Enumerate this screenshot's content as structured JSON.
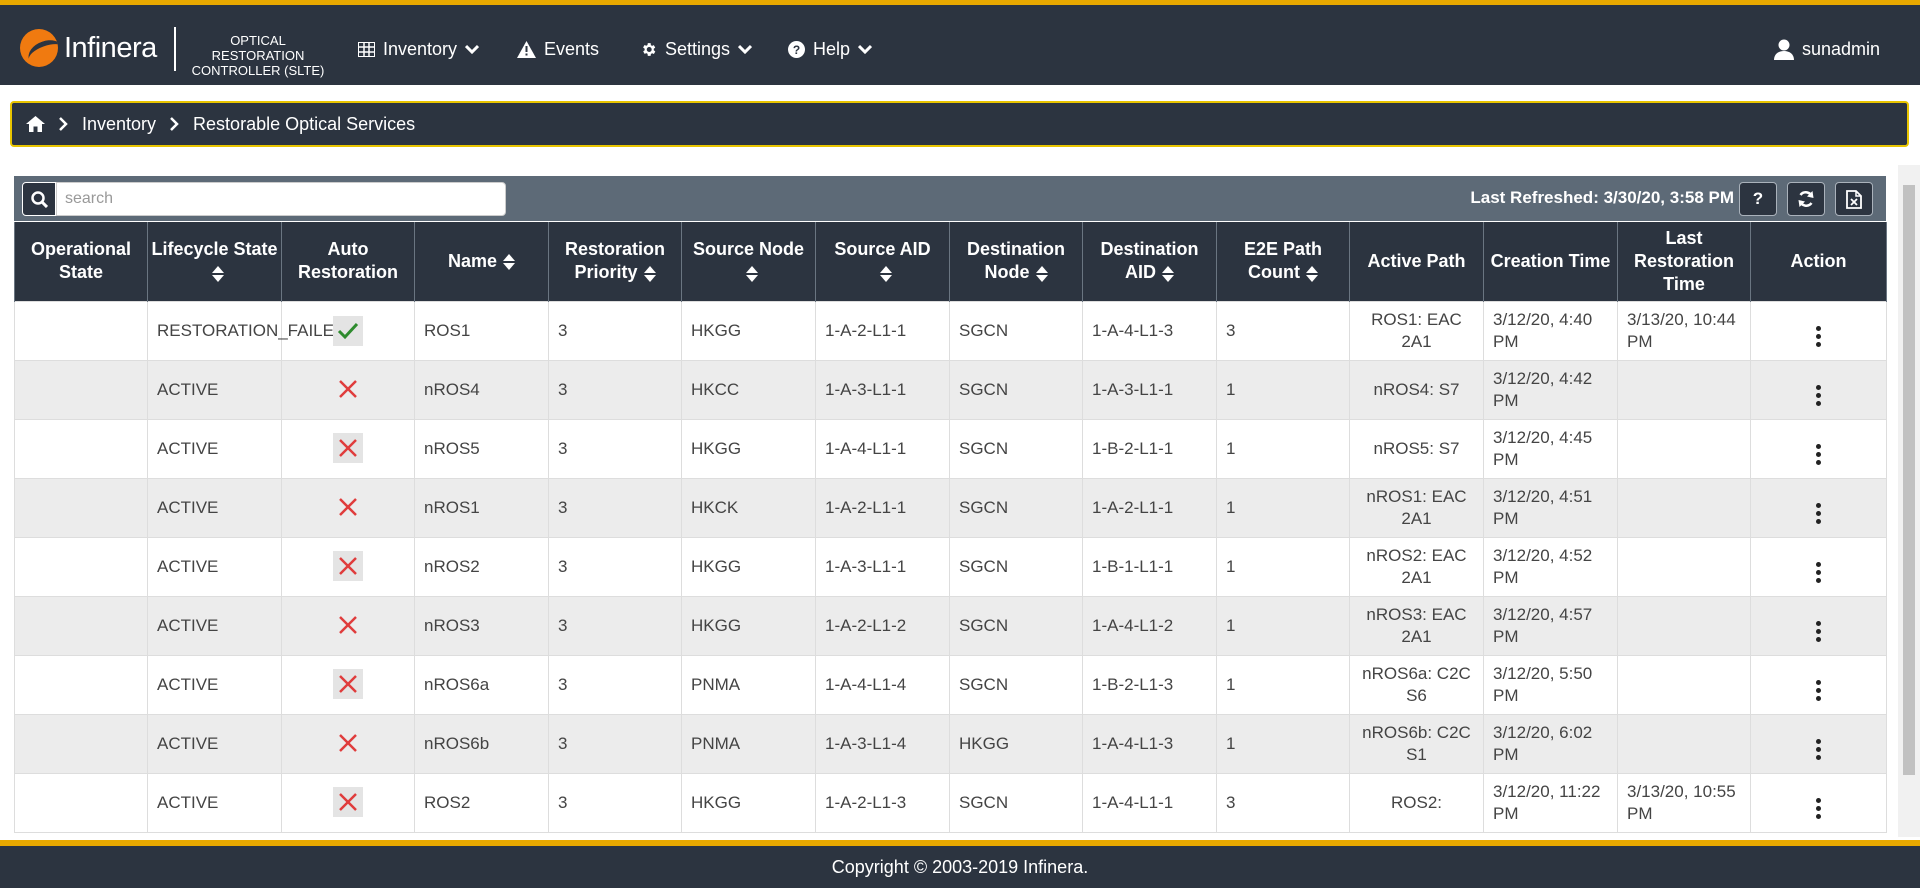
{
  "brand": {
    "logo_text": "Infinera",
    "product_line1": "OPTICAL RESTORATION",
    "product_line2": "CONTROLLER (SLTE)"
  },
  "nav": {
    "inventory": "Inventory",
    "events": "Events",
    "settings": "Settings",
    "help": "Help",
    "user": "sunadmin"
  },
  "breadcrumb": {
    "item1": "Inventory",
    "item2": "Restorable Optical Services"
  },
  "toolbar": {
    "search_placeholder": "search",
    "last_refreshed": "Last Refreshed: 3/30/20, 3:58 PM",
    "help_label": "?"
  },
  "columns": {
    "operational_state": "Operational State",
    "lifecycle_state": "Lifecycle State",
    "auto_restoration": "Auto Restoration",
    "name": "Name",
    "restoration_priority": "Restoration Priority",
    "source_node": "Source Node",
    "source_aid": "Source AID",
    "destination_node": "Destination Node",
    "destination_aid": "Destination AID",
    "e2e_path_count": "E2E Path Count",
    "active_path": "Active Path",
    "creation_time": "Creation Time",
    "last_restoration_time": "Last Restoration Time",
    "action": "Action"
  },
  "rows": [
    {
      "operational_state": "",
      "lifecycle_state": "RESTORATION_FAILED",
      "auto_restoration": true,
      "name": "ROS1",
      "priority": "3",
      "source_node": "HKGG",
      "source_aid": "1-A-2-L1-1",
      "destination_node": "SGCN",
      "destination_aid": "1-A-4-L1-3",
      "e2e_path_count": "3",
      "active_path": "ROS1: EAC 2A1",
      "creation_time": "3/12/20, 4:40 PM",
      "last_restoration_time": "3/13/20, 10:44 PM"
    },
    {
      "operational_state": "",
      "lifecycle_state": "ACTIVE",
      "auto_restoration": false,
      "name": "nROS4",
      "priority": "3",
      "source_node": "HKCC",
      "source_aid": "1-A-3-L1-1",
      "destination_node": "SGCN",
      "destination_aid": "1-A-3-L1-1",
      "e2e_path_count": "1",
      "active_path": "nROS4: S7",
      "creation_time": "3/12/20, 4:42 PM",
      "last_restoration_time": ""
    },
    {
      "operational_state": "",
      "lifecycle_state": "ACTIVE",
      "auto_restoration": false,
      "name": "nROS5",
      "priority": "3",
      "source_node": "HKGG",
      "source_aid": "1-A-4-L1-1",
      "destination_node": "SGCN",
      "destination_aid": "1-B-2-L1-1",
      "e2e_path_count": "1",
      "active_path": "nROS5: S7",
      "creation_time": "3/12/20, 4:45 PM",
      "last_restoration_time": ""
    },
    {
      "operational_state": "",
      "lifecycle_state": "ACTIVE",
      "auto_restoration": false,
      "name": "nROS1",
      "priority": "3",
      "source_node": "HKCK",
      "source_aid": "1-A-2-L1-1",
      "destination_node": "SGCN",
      "destination_aid": "1-A-2-L1-1",
      "e2e_path_count": "1",
      "active_path": "nROS1: EAC 2A1",
      "creation_time": "3/12/20, 4:51 PM",
      "last_restoration_time": ""
    },
    {
      "operational_state": "",
      "lifecycle_state": "ACTIVE",
      "auto_restoration": false,
      "name": "nROS2",
      "priority": "3",
      "source_node": "HKGG",
      "source_aid": "1-A-3-L1-1",
      "destination_node": "SGCN",
      "destination_aid": "1-B-1-L1-1",
      "e2e_path_count": "1",
      "active_path": "nROS2: EAC 2A1",
      "creation_time": "3/12/20, 4:52 PM",
      "last_restoration_time": ""
    },
    {
      "operational_state": "",
      "lifecycle_state": "ACTIVE",
      "auto_restoration": false,
      "name": "nROS3",
      "priority": "3",
      "source_node": "HKGG",
      "source_aid": "1-A-2-L1-2",
      "destination_node": "SGCN",
      "destination_aid": "1-A-4-L1-2",
      "e2e_path_count": "1",
      "active_path": "nROS3: EAC 2A1",
      "creation_time": "3/12/20, 4:57 PM",
      "last_restoration_time": ""
    },
    {
      "operational_state": "",
      "lifecycle_state": "ACTIVE",
      "auto_restoration": false,
      "name": "nROS6a",
      "priority": "3",
      "source_node": "PNMA",
      "source_aid": "1-A-4-L1-4",
      "destination_node": "SGCN",
      "destination_aid": "1-B-2-L1-3",
      "e2e_path_count": "1",
      "active_path": "nROS6a: C2C S6",
      "creation_time": "3/12/20, 5:50 PM",
      "last_restoration_time": ""
    },
    {
      "operational_state": "",
      "lifecycle_state": "ACTIVE",
      "auto_restoration": false,
      "name": "nROS6b",
      "priority": "3",
      "source_node": "PNMA",
      "source_aid": "1-A-3-L1-4",
      "destination_node": "HKGG",
      "destination_aid": "1-A-4-L1-3",
      "e2e_path_count": "1",
      "active_path": "nROS6b: C2C S1",
      "creation_time": "3/12/20, 6:02 PM",
      "last_restoration_time": ""
    },
    {
      "operational_state": "",
      "lifecycle_state": "ACTIVE",
      "auto_restoration": false,
      "name": "ROS2",
      "priority": "3",
      "source_node": "HKGG",
      "source_aid": "1-A-2-L1-3",
      "destination_node": "SGCN",
      "destination_aid": "1-A-4-L1-1",
      "e2e_path_count": "3",
      "active_path": "ROS2:",
      "creation_time": "3/12/20, 11:22 PM",
      "last_restoration_time": "3/13/20, 10:55 PM"
    }
  ],
  "icons": {
    "check_color": "#2e8b2e",
    "cross_color": "#e03c3c",
    "accent": "#e8a800"
  },
  "footer": {
    "copyright": "Copyright © 2003-2019 Infinera."
  }
}
